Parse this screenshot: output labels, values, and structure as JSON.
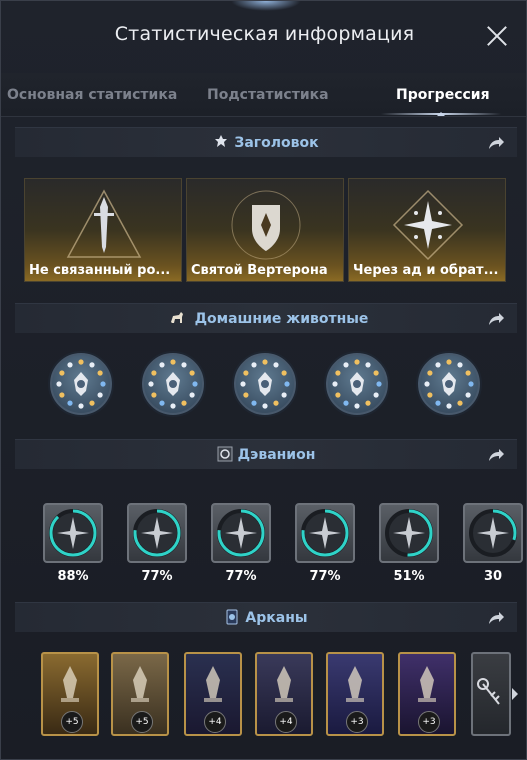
{
  "window": {
    "title": "Статистическая информация"
  },
  "tabs": [
    {
      "label": "Основная статистика",
      "active": false
    },
    {
      "label": "Подстатистика",
      "active": false
    },
    {
      "label": "Прогрессия",
      "active": true
    }
  ],
  "sections": {
    "title": {
      "label": "Заголовок"
    },
    "pets": {
      "label": "Домашние животные"
    },
    "daevanion": {
      "label": "Дэванион"
    },
    "arcana": {
      "label": "Арканы"
    }
  },
  "titles": [
    {
      "label": "Не связанный ро...",
      "icon": "sword-triangle-icon"
    },
    {
      "label": "Святой Вертерона",
      "icon": "shield-crest-icon"
    },
    {
      "label": "Через ад и обрат...",
      "icon": "star-diamond-icon"
    }
  ],
  "pets": [
    {
      "icon": "mask-pet-icon"
    },
    {
      "icon": "wolf-pet-icon"
    },
    {
      "icon": "lotus-pet-icon"
    },
    {
      "icon": "gear-pet-icon"
    },
    {
      "icon": "leaf-pet-icon"
    }
  ],
  "daevanion": [
    {
      "percent": "88%",
      "fill": 0.88,
      "icon": "sword-rune-icon"
    },
    {
      "percent": "77%",
      "fill": 0.77,
      "icon": "wing-rune-icon"
    },
    {
      "percent": "77%",
      "fill": 0.77,
      "icon": "bow-rune-icon"
    },
    {
      "percent": "77%",
      "fill": 0.77,
      "icon": "cross-blade-rune-icon"
    },
    {
      "percent": "51%",
      "fill": 0.51,
      "icon": "star-rune-icon"
    },
    {
      "percent": "30",
      "fill": 0.3,
      "icon": "moon-rune-icon"
    }
  ],
  "arcana": [
    {
      "level": "+5",
      "icon": "chalice-card-icon"
    },
    {
      "level": "+5",
      "icon": "scroll-card-icon"
    },
    {
      "level": "+4",
      "icon": "tree-card-icon"
    },
    {
      "level": "+4",
      "icon": "bell-card-icon"
    },
    {
      "level": "+3",
      "icon": "hand-card-icon"
    },
    {
      "level": "+3",
      "icon": "crystal-card-icon"
    }
  ],
  "colors": {
    "accent": "#9cc3e8",
    "progress": "#2fd3c8",
    "gold": "#b89248"
  }
}
